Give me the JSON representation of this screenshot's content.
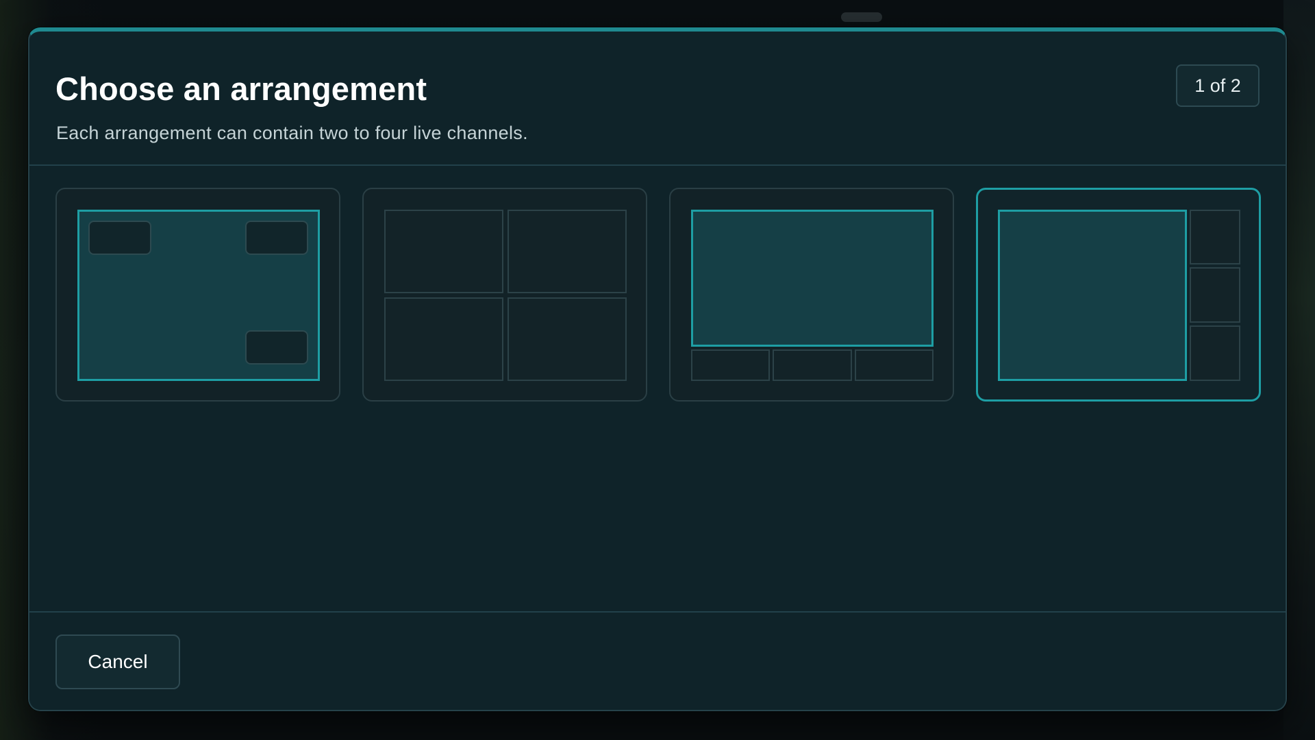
{
  "dialog": {
    "title": "Choose an arrangement",
    "subtitle": "Each arrangement can contain two to four live channels.",
    "step": "1 of 2"
  },
  "arrangements": [
    {
      "name": "picture-in-picture",
      "selected": false
    },
    {
      "name": "quad-grid",
      "selected": false
    },
    {
      "name": "main-with-bottom-row",
      "selected": false
    },
    {
      "name": "main-with-side-column",
      "selected": true
    }
  ],
  "footer": {
    "cancel_label": "Cancel"
  },
  "colors": {
    "accent": "#1e9ea4",
    "modal_bg": "#0f2329",
    "main_pane": "#153f46"
  }
}
